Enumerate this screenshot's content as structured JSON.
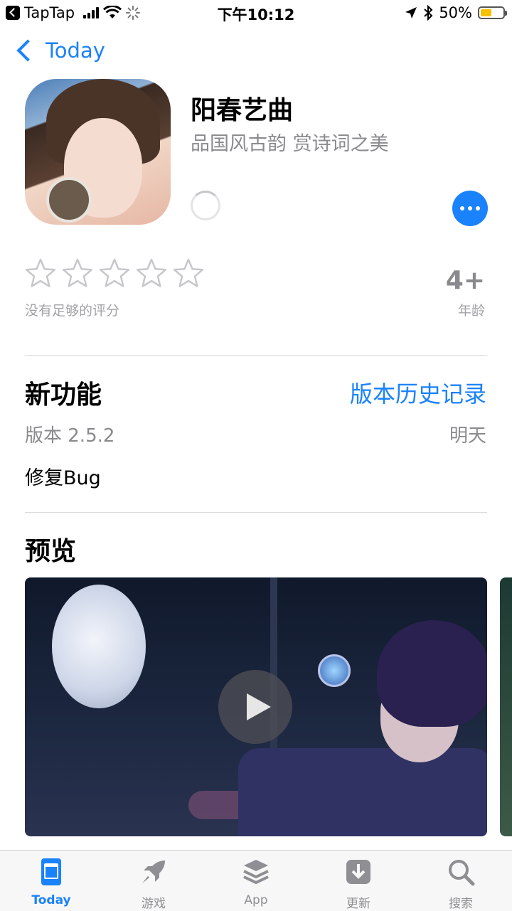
{
  "status_bar": {
    "back_app": "TapTap",
    "time": "下午10:12",
    "battery": "50%",
    "battery_level": 0.5
  },
  "nav": {
    "back_label": "Today"
  },
  "app": {
    "title": "阳春艺曲",
    "subtitle": "品国风古韵 赏诗词之美"
  },
  "ratings": {
    "stars_filled": 0,
    "stars_total": 5,
    "note": "没有足够的评分",
    "age": "4+",
    "age_label": "年龄"
  },
  "whats_new": {
    "title": "新功能",
    "history_link": "版本历史记录",
    "version": "版本 2.5.2",
    "release": "明天",
    "notes": "修复Bug"
  },
  "preview": {
    "title": "预览"
  },
  "tabbar": {
    "tabs": [
      {
        "label": "Today",
        "icon": "today-icon",
        "active": true
      },
      {
        "label": "游戏",
        "icon": "rocket-icon",
        "active": false
      },
      {
        "label": "App",
        "icon": "layers-icon",
        "active": false
      },
      {
        "label": "更新",
        "icon": "download-icon",
        "active": false
      },
      {
        "label": "搜索",
        "icon": "search-icon",
        "active": false
      }
    ]
  },
  "colors": {
    "accent": "#1a82fb",
    "secondary_text": "#8a8a8e"
  }
}
